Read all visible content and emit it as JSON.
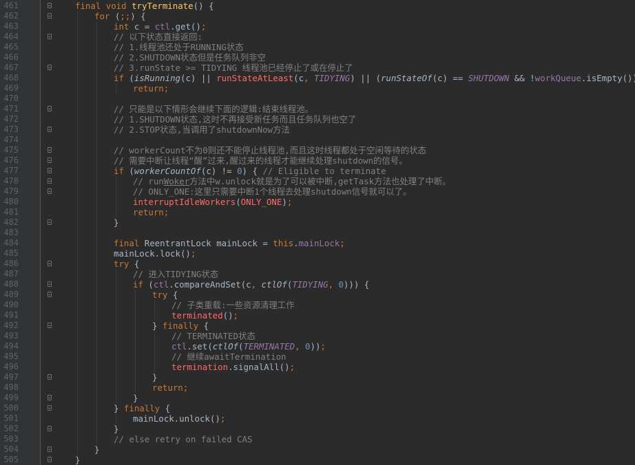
{
  "editor": {
    "colors": {
      "background": "#2b2b2b",
      "gutter": "#313335",
      "keyword": "#cc7832",
      "function": "#ffc66d",
      "comment": "#808080",
      "field": "#9876aa",
      "number": "#6897bb",
      "modified_call": "#ff6b68",
      "default": "#a9b7c6"
    },
    "lines": [
      {
        "n": "461",
        "indent": 0,
        "fold": true,
        "tokens": [
          [
            "kw",
            "final "
          ],
          [
            "kw",
            "void "
          ],
          [
            "fn",
            "tryTerminate"
          ],
          [
            "",
            "() {"
          ]
        ]
      },
      {
        "n": "462",
        "indent": 1,
        "fold": true,
        "tokens": [
          [
            "kw",
            "for "
          ],
          [
            "",
            "("
          ],
          [
            "kw",
            ";;"
          ],
          [
            "",
            ") {"
          ]
        ]
      },
      {
        "n": "463",
        "indent": 2,
        "tokens": [
          [
            "kw",
            "int "
          ],
          [
            "",
            "c = "
          ],
          [
            "fd",
            "ctl"
          ],
          [
            "",
            ".get()"
          ],
          [
            "kw",
            ";"
          ]
        ]
      },
      {
        "n": "464",
        "indent": 2,
        "fold": true,
        "tokens": [
          [
            "cm",
            "// 以下状态直接返回:"
          ]
        ]
      },
      {
        "n": "465",
        "indent": 2,
        "tokens": [
          [
            "cm",
            "// 1.线程池还处于RUNNING状态"
          ]
        ]
      },
      {
        "n": "466",
        "indent": 2,
        "tokens": [
          [
            "cm",
            "// 2.SHUTDOWN状态但是任务队列非空"
          ]
        ]
      },
      {
        "n": "467",
        "indent": 2,
        "fold": true,
        "tokens": [
          [
            "cm",
            "// 3.runState >= TIDYING 线程池已经停止了或在停止了"
          ]
        ]
      },
      {
        "n": "468",
        "indent": 2,
        "tokens": [
          [
            "kw",
            "if "
          ],
          [
            "",
            "("
          ],
          [
            "it",
            "isRunning"
          ],
          [
            "",
            "(c) || "
          ],
          [
            "mc",
            "runStateAtLeast"
          ],
          [
            "",
            "(c"
          ],
          [
            "kw",
            ", "
          ],
          [
            "cs",
            "TIDYING"
          ],
          [
            "",
            ") || ("
          ],
          [
            "it",
            "runStateOf"
          ],
          [
            "",
            "(c) == "
          ],
          [
            "cs",
            "SHUTDOWN"
          ],
          [
            "",
            " && !"
          ],
          [
            "fd",
            "workQueue"
          ],
          [
            "",
            ".isEmpty()))"
          ]
        ]
      },
      {
        "n": "469",
        "indent": 3,
        "tokens": [
          [
            "kw",
            "return;"
          ]
        ]
      },
      {
        "n": "470",
        "indent": 2,
        "tokens": []
      },
      {
        "n": "471",
        "indent": 2,
        "fold": true,
        "tokens": [
          [
            "cm",
            "// 只能是以下情形会继续下面的逻辑:结束线程池。"
          ]
        ]
      },
      {
        "n": "472",
        "indent": 2,
        "tokens": [
          [
            "cm",
            "// 1.SHUTDOWN状态,这时不再接受新任务而且任务队列也空了"
          ]
        ]
      },
      {
        "n": "473",
        "indent": 2,
        "fold": true,
        "tokens": [
          [
            "cm",
            "// 2.STOP状态,当调用了shutdownNow方法"
          ]
        ]
      },
      {
        "n": "474",
        "indent": 2,
        "tokens": []
      },
      {
        "n": "475",
        "indent": 2,
        "fold": true,
        "tokens": [
          [
            "cm",
            "// workerCount不为0则还不能停止线程池,而且这时线程都处于空闲等待的状态"
          ]
        ]
      },
      {
        "n": "476",
        "indent": 2,
        "fold": true,
        "tokens": [
          [
            "cm",
            "// 需要中断让线程“醒”过来,醒过来的线程才能继续处理shutdown的信号。"
          ]
        ]
      },
      {
        "n": "477",
        "indent": 2,
        "fold": true,
        "tokens": [
          [
            "kw",
            "if "
          ],
          [
            "",
            "("
          ],
          [
            "it",
            "workerCountOf"
          ],
          [
            "",
            "(c) != "
          ],
          [
            "num",
            "0"
          ],
          [
            "",
            ") { "
          ],
          [
            "cm",
            "// Eligible to terminate"
          ]
        ]
      },
      {
        "n": "478",
        "indent": 3,
        "fold": true,
        "tokens": [
          [
            "cm",
            "// run"
          ],
          [
            "cm und",
            "Woker"
          ],
          [
            "cm",
            "方法中w.unlock就是为了可以被中断,getTask方法也处理了中断。"
          ]
        ]
      },
      {
        "n": "479",
        "indent": 3,
        "fold": true,
        "tokens": [
          [
            "cm",
            "// ONLY_ONE:这里只需要中断1个线程去处理shutdown信号就可以了。"
          ]
        ]
      },
      {
        "n": "480",
        "indent": 3,
        "tokens": [
          [
            "mc",
            "interruptIdleWorkers"
          ],
          [
            "",
            "("
          ],
          [
            "mc",
            "ONLY_ONE"
          ],
          [
            ")"
          ],
          [
            "kw",
            ";"
          ]
        ]
      },
      {
        "n": "481",
        "indent": 3,
        "tokens": [
          [
            "kw",
            "return;"
          ]
        ]
      },
      {
        "n": "482",
        "indent": 2,
        "fold": true,
        "tokens": [
          [
            "",
            "}"
          ]
        ]
      },
      {
        "n": "483",
        "indent": 2,
        "tokens": []
      },
      {
        "n": "484",
        "indent": 2,
        "tokens": [
          [
            "kw",
            "final "
          ],
          [
            "",
            "ReentrantLock mainLock = "
          ],
          [
            "kw",
            "this"
          ],
          [
            "",
            "."
          ],
          [
            "fd",
            "mainLock"
          ],
          [
            "kw",
            ";"
          ]
        ]
      },
      {
        "n": "485",
        "indent": 2,
        "tokens": [
          [
            "",
            "mainLock.lock()"
          ],
          [
            "kw",
            ";"
          ]
        ]
      },
      {
        "n": "486",
        "indent": 2,
        "fold": true,
        "tokens": [
          [
            "kw",
            "try "
          ],
          [
            "",
            "{"
          ]
        ]
      },
      {
        "n": "487",
        "indent": 3,
        "tokens": [
          [
            "cm",
            "// 进入TIDYING状态"
          ]
        ]
      },
      {
        "n": "488",
        "indent": 3,
        "fold": true,
        "tokens": [
          [
            "kw",
            "if "
          ],
          [
            "",
            "("
          ],
          [
            "fd",
            "ctl"
          ],
          [
            "",
            ".compareAndSet(c"
          ],
          [
            "kw",
            ", "
          ],
          [
            "it",
            "ctlOf"
          ],
          [
            "",
            "("
          ],
          [
            "cs",
            "TIDYING"
          ],
          [
            "kw",
            ", "
          ],
          [
            "num",
            "0"
          ],
          [
            "",
            "))) {"
          ]
        ]
      },
      {
        "n": "489",
        "indent": 4,
        "fold": true,
        "tokens": [
          [
            "kw",
            "try "
          ],
          [
            "",
            "{"
          ]
        ]
      },
      {
        "n": "490",
        "indent": 5,
        "tokens": [
          [
            "cm",
            "// 子类重载:一些资源清理工作"
          ]
        ]
      },
      {
        "n": "491",
        "indent": 5,
        "tokens": [
          [
            "mc",
            "terminated"
          ],
          [
            "",
            "()"
          ],
          [
            "kw",
            ";"
          ]
        ]
      },
      {
        "n": "492",
        "indent": 4,
        "fold": true,
        "tokens": [
          [
            "",
            "} "
          ],
          [
            "kw",
            "finally "
          ],
          [
            "",
            "{"
          ]
        ]
      },
      {
        "n": "493",
        "indent": 5,
        "tokens": [
          [
            "cm",
            "// TERMINATED状态"
          ]
        ]
      },
      {
        "n": "494",
        "indent": 5,
        "tokens": [
          [
            "fd",
            "ctl"
          ],
          [
            "",
            ".set("
          ],
          [
            "it",
            "ctlOf"
          ],
          [
            "",
            "("
          ],
          [
            "cs",
            "TERMINATED"
          ],
          [
            "kw",
            ", "
          ],
          [
            "num",
            "0"
          ],
          [
            "",
            "))"
          ],
          [
            "kw",
            ";"
          ]
        ]
      },
      {
        "n": "495",
        "indent": 5,
        "tokens": [
          [
            "cm",
            "// 继续awaitTermination"
          ]
        ]
      },
      {
        "n": "496",
        "indent": 5,
        "tokens": [
          [
            "mc",
            "termination"
          ],
          [
            "",
            ".signalAll()"
          ],
          [
            "kw",
            ";"
          ]
        ]
      },
      {
        "n": "497",
        "indent": 4,
        "fold": true,
        "tokens": [
          [
            "",
            "}"
          ]
        ]
      },
      {
        "n": "498",
        "indent": 4,
        "tokens": [
          [
            "kw",
            "return;"
          ]
        ]
      },
      {
        "n": "499",
        "indent": 3,
        "fold": true,
        "tokens": [
          [
            "",
            "}"
          ]
        ]
      },
      {
        "n": "500",
        "indent": 2,
        "fold": true,
        "tokens": [
          [
            "",
            "} "
          ],
          [
            "kw",
            "finally "
          ],
          [
            "",
            "{"
          ]
        ]
      },
      {
        "n": "501",
        "indent": 3,
        "tokens": [
          [
            "",
            "mainLock.unlock()"
          ],
          [
            "kw",
            ";"
          ]
        ]
      },
      {
        "n": "502",
        "indent": 2,
        "fold": true,
        "tokens": [
          [
            "",
            "}"
          ]
        ]
      },
      {
        "n": "503",
        "indent": 2,
        "tokens": [
          [
            "cm",
            "// else retry on failed CAS"
          ]
        ]
      },
      {
        "n": "504",
        "indent": 1,
        "fold": true,
        "tokens": [
          [
            "",
            "}"
          ]
        ]
      },
      {
        "n": "505",
        "indent": 0,
        "fold": true,
        "tokens": [
          [
            "",
            "}"
          ]
        ]
      }
    ]
  }
}
